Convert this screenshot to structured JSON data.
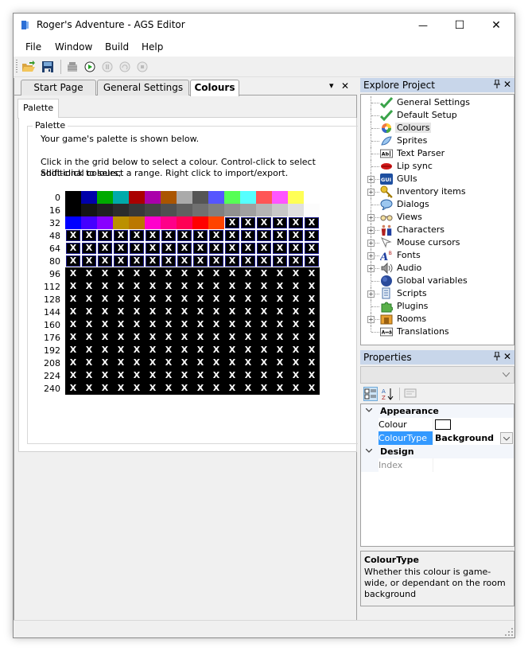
{
  "window": {
    "title": "Roger's Adventure - AGS Editor",
    "controls": {
      "minimize": "—",
      "maximize": "☐",
      "close": "✕"
    }
  },
  "menubar": {
    "items": [
      {
        "label": "File"
      },
      {
        "label": "Window"
      },
      {
        "label": "Build"
      },
      {
        "label": "Help"
      }
    ]
  },
  "toolbar": {
    "buttons": [
      {
        "name": "open-project",
        "icon": "folder-open-icon",
        "enabled": true
      },
      {
        "name": "save-project",
        "icon": "floppy-disk-icon",
        "enabled": true
      },
      {
        "name": "build-exe",
        "icon": "build-gears-icon",
        "enabled": false
      },
      {
        "name": "run-game",
        "icon": "play-icon",
        "enabled": true
      },
      {
        "name": "pause-game",
        "icon": "pause-icon",
        "enabled": false
      },
      {
        "name": "step-game",
        "icon": "step-icon",
        "enabled": false
      },
      {
        "name": "stop-game",
        "icon": "stop-icon",
        "enabled": false
      }
    ]
  },
  "documents": {
    "tabs": [
      {
        "label": "Start Page",
        "active": false
      },
      {
        "label": "General Settings",
        "active": false
      },
      {
        "label": "Colours",
        "active": true
      }
    ],
    "dropdown_glyph": "▾",
    "close_glyph": "✕"
  },
  "palette_editor": {
    "subtab": "Palette",
    "group_title": "Palette",
    "intro": "Your game's palette is shown below.",
    "instructions_line1": "Click in the grid below to select a colour. Control-click to select additional colours;",
    "instructions_line2": "Shift-click to select a range.  Right click to import/export.",
    "cell_marker": "X",
    "row_labels": [
      "0",
      "16",
      "32",
      "48",
      "64",
      "80",
      "96",
      "112",
      "128",
      "144",
      "160",
      "176",
      "192",
      "208",
      "224",
      "240"
    ],
    "fixed_colors": [
      "#000000",
      "#0000aa",
      "#00aa00",
      "#00aaaa",
      "#aa0000",
      "#aa00aa",
      "#aa5500",
      "#aaaaaa",
      "#555555",
      "#5555ff",
      "#55ff55",
      "#55ffff",
      "#ff5555",
      "#ff55ff",
      "#ffff55",
      "#ffffff",
      "#000000",
      "#141414",
      "#202020",
      "#2c2c2c",
      "#383838",
      "#444444",
      "#505050",
      "#606060",
      "#707070",
      "#808080",
      "#909090",
      "#a0a0a0",
      "#b4b4b4",
      "#c8c8c8",
      "#e0e0e0",
      "#fcfcfc",
      "#0000ff",
      "#4400ff",
      "#8800ff",
      "#bb9000",
      "#bb7800",
      "#ff00cc",
      "#ff0088",
      "#ff0055",
      "#ff0000",
      "#ff4400"
    ],
    "boxed_x_range": [
      42,
      95
    ],
    "plain_x_range": [
      96,
      255
    ]
  },
  "explorer": {
    "title": "Explore Project",
    "pin_glyph": "📌",
    "close_glyph": "✕",
    "items": [
      {
        "label": "General Settings",
        "icon": "checkmark-icon",
        "expandable": false,
        "selected": false
      },
      {
        "label": "Default Setup",
        "icon": "checkmark-icon",
        "expandable": false,
        "selected": false
      },
      {
        "label": "Colours",
        "icon": "color-wheel-icon",
        "expandable": false,
        "selected": true
      },
      {
        "label": "Sprites",
        "icon": "sprite-fish-icon",
        "expandable": false,
        "selected": false
      },
      {
        "label": "Text Parser",
        "icon": "text-parser-icon",
        "expandable": false,
        "selected": false
      },
      {
        "label": "Lip sync",
        "icon": "lips-icon",
        "expandable": false,
        "selected": false
      },
      {
        "label": "GUIs",
        "icon": "gui-icon",
        "expandable": true,
        "selected": false
      },
      {
        "label": "Inventory items",
        "icon": "key-icon",
        "expandable": true,
        "selected": false
      },
      {
        "label": "Dialogs",
        "icon": "speech-bubble-icon",
        "expandable": false,
        "selected": false
      },
      {
        "label": "Views",
        "icon": "glasses-icon",
        "expandable": true,
        "selected": false
      },
      {
        "label": "Characters",
        "icon": "characters-icon",
        "expandable": true,
        "selected": false
      },
      {
        "label": "Mouse cursors",
        "icon": "cursor-icon",
        "expandable": true,
        "selected": false
      },
      {
        "label": "Fonts",
        "icon": "font-icon",
        "expandable": true,
        "selected": false
      },
      {
        "label": "Audio",
        "icon": "speaker-icon",
        "expandable": true,
        "selected": false
      },
      {
        "label": "Global variables",
        "icon": "globe-icon",
        "expandable": false,
        "selected": false
      },
      {
        "label": "Scripts",
        "icon": "script-icon",
        "expandable": true,
        "selected": false
      },
      {
        "label": "Plugins",
        "icon": "puzzle-icon",
        "expandable": false,
        "selected": false
      },
      {
        "label": "Rooms",
        "icon": "rooms-icon",
        "expandable": true,
        "selected": false
      },
      {
        "label": "Translations",
        "icon": "translation-icon",
        "expandable": false,
        "selected": false
      }
    ]
  },
  "properties": {
    "title": "Properties",
    "pin_glyph": "📌",
    "close_glyph": "✕",
    "object_selector": "",
    "categories": [
      {
        "name": "Appearance",
        "rows": [
          {
            "name": "Colour",
            "value": "",
            "swatch": "#ffffff",
            "selected": false,
            "readonly": false
          },
          {
            "name": "ColourType",
            "value": "Background",
            "selected": true,
            "readonly": false
          }
        ]
      },
      {
        "name": "Design",
        "rows": [
          {
            "name": "Index",
            "value": "",
            "selected": false,
            "readonly": true
          }
        ]
      }
    ],
    "help_title": "ColourType",
    "help_text": "Whether this colour is game-wide, or dependant on the room background"
  },
  "colors": {
    "pane_header": "#c8d6ea",
    "selection": "#3399ff",
    "boxed_cell_border": "#1a1a8a"
  }
}
